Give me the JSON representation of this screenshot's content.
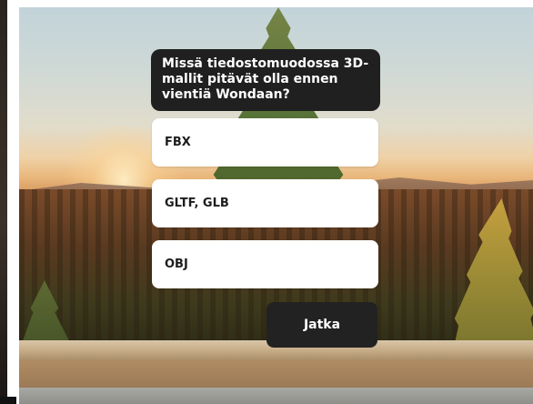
{
  "quiz": {
    "question": "Missä tiedostomuodossa 3D-mallit pitävät olla ennen vientiä Wondaan?",
    "answers": [
      {
        "label": "FBX"
      },
      {
        "label": "GLTF, GLB"
      },
      {
        "label": "OBJ"
      }
    ],
    "continue_label": "Jatka"
  },
  "colors": {
    "question_bg": "#202020",
    "answer_bg": "#ffffff",
    "button_bg": "#222222",
    "text_light": "#ffffff",
    "text_dark": "#1d1d1d"
  }
}
